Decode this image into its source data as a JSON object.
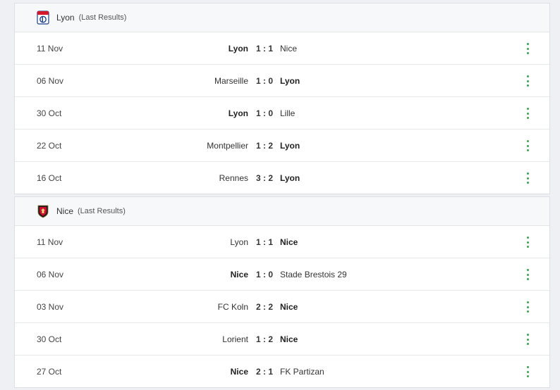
{
  "sections": [
    {
      "team": "Lyon",
      "subtitle": "(Last Results)",
      "logo_icon": "lyon-crest-icon",
      "matches": [
        {
          "date": "11 Nov",
          "home": "Lyon",
          "score": "1 : 1",
          "away": "Nice",
          "bold": "home"
        },
        {
          "date": "06 Nov",
          "home": "Marseille",
          "score": "1 : 0",
          "away": "Lyon",
          "bold": "away"
        },
        {
          "date": "30 Oct",
          "home": "Lyon",
          "score": "1 : 0",
          "away": "Lille",
          "bold": "home"
        },
        {
          "date": "22 Oct",
          "home": "Montpellier",
          "score": "1 : 2",
          "away": "Lyon",
          "bold": "away"
        },
        {
          "date": "16 Oct",
          "home": "Rennes",
          "score": "3 : 2",
          "away": "Lyon",
          "bold": "away"
        }
      ]
    },
    {
      "team": "Nice",
      "subtitle": "(Last Results)",
      "logo_icon": "nice-crest-icon",
      "matches": [
        {
          "date": "11 Nov",
          "home": "Lyon",
          "score": "1 : 1",
          "away": "Nice",
          "bold": "away"
        },
        {
          "date": "06 Nov",
          "home": "Nice",
          "score": "1 : 0",
          "away": "Stade Brestois 29",
          "bold": "home"
        },
        {
          "date": "03 Nov",
          "home": "FC Koln",
          "score": "2 : 2",
          "away": "Nice",
          "bold": "away"
        },
        {
          "date": "30 Oct",
          "home": "Lorient",
          "score": "1 : 2",
          "away": "Nice",
          "bold": "away"
        },
        {
          "date": "27 Oct",
          "home": "Nice",
          "score": "2 : 1",
          "away": "FK Partizan",
          "bold": "home"
        }
      ]
    }
  ],
  "colors": {
    "menu_dots": "#3fa34d",
    "lyon_red": "#d7182a",
    "lyon_blue": "#1b3f8b",
    "nice_red": "#c8102e",
    "nice_black": "#1a1a1a"
  }
}
